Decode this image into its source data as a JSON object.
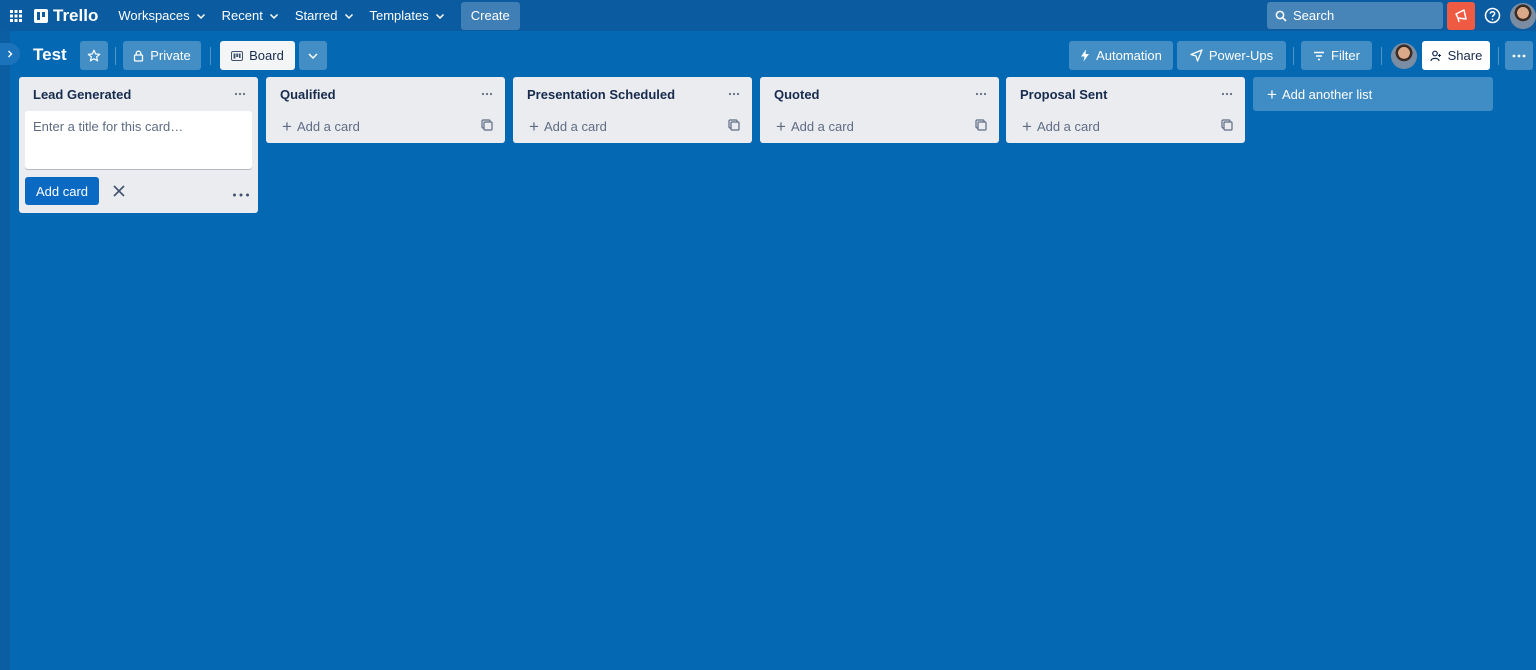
{
  "topbar": {
    "app_name": "Trello",
    "nav": [
      {
        "label": "Workspaces",
        "icon": "chevron-down-icon"
      },
      {
        "label": "Recent",
        "icon": "chevron-down-icon"
      },
      {
        "label": "Starred",
        "icon": "chevron-down-icon"
      },
      {
        "label": "Templates",
        "icon": "chevron-down-icon"
      }
    ],
    "create_label": "Create",
    "search_placeholder": "Search",
    "icons": [
      "apps-grid-icon",
      "trello-logo-icon",
      "search-icon",
      "notification-megaphone-icon",
      "help-icon",
      "avatar"
    ]
  },
  "board": {
    "title": "Test",
    "visibility_label": "Private",
    "view_label": "Board",
    "automation_label": "Automation",
    "powerups_label": "Power-Ups",
    "filter_label": "Filter",
    "share_label": "Share",
    "colors": {
      "background": "#0468b2",
      "navbar": "#0a5ba0",
      "list": "#ebecf0",
      "primary_button": "#0a6ac3",
      "notification": "#ef5a42"
    }
  },
  "lists": [
    {
      "title": "Lead Generated",
      "composer": {
        "placeholder": "Enter a title for this card…",
        "value": "",
        "add_label": "Add card"
      }
    },
    {
      "title": "Qualified",
      "add_card_label": "Add a card"
    },
    {
      "title": "Presentation Scheduled",
      "add_card_label": "Add a card"
    },
    {
      "title": "Quoted",
      "add_card_label": "Add a card"
    },
    {
      "title": "Proposal Sent",
      "add_card_label": "Add a card"
    }
  ],
  "add_list_label": "Add another list"
}
